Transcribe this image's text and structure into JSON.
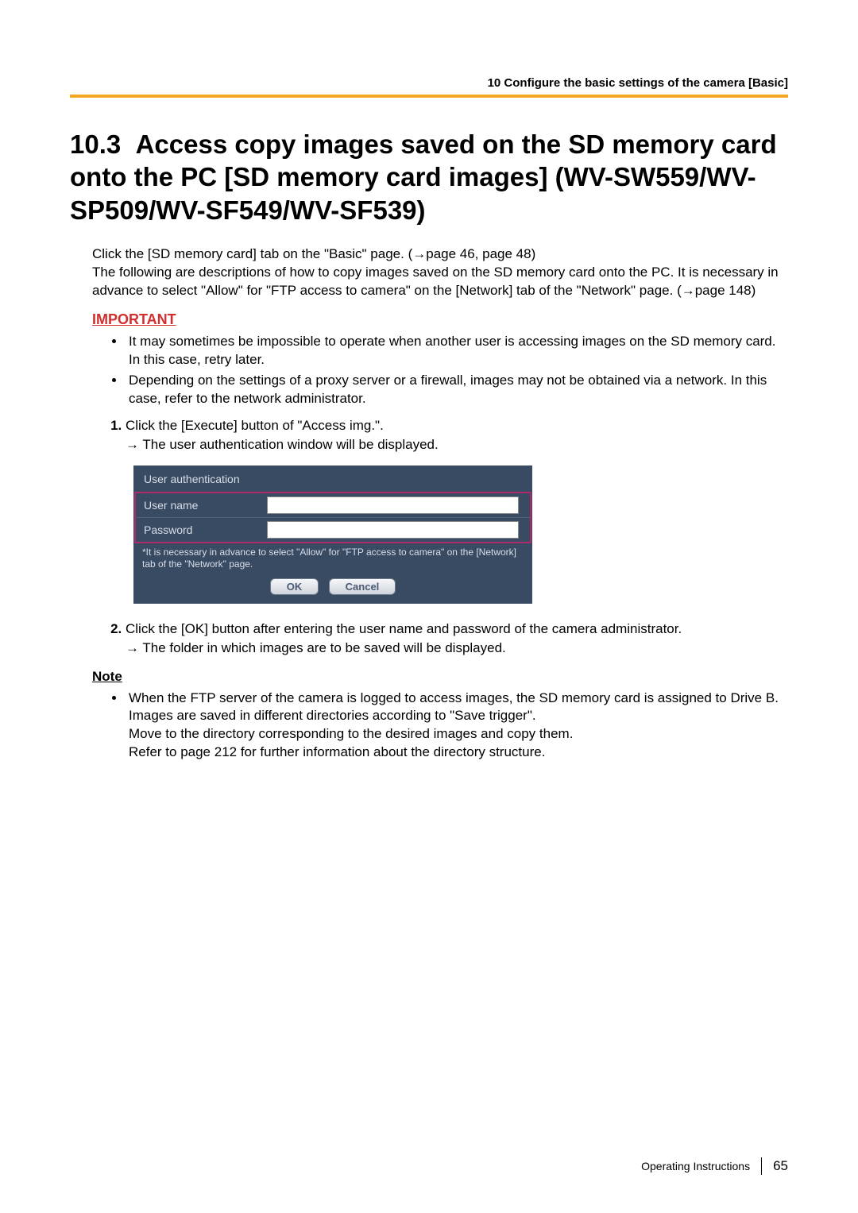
{
  "header": {
    "breadcrumb": "10 Configure the basic settings of the camera [Basic]"
  },
  "section": {
    "number": "10.3",
    "title": "Access copy images saved on the SD memory card onto the PC [SD memory card images] (WV-SW559/WV-SP509/WV-SF549/WV-SF539)"
  },
  "intro": {
    "line1": "Click the [SD memory card] tab on the \"Basic\" page. (→page 46, page 48)",
    "line2": "The following are descriptions of how to copy images saved on the SD memory card onto the PC. It is necessary in advance to select \"Allow\" for \"FTP access to camera\" on the [Network] tab of the \"Network\" page. (→page 148)"
  },
  "important": {
    "label": "IMPORTANT",
    "items": [
      "It may sometimes be impossible to operate when another user is accessing images on the SD memory card. In this case, retry later.",
      "Depending on the settings of a proxy server or a firewall, images may not be obtained via a network. In this case, refer to the network administrator."
    ]
  },
  "steps": [
    {
      "text": "Click the [Execute] button of \"Access img.\".",
      "arrow": "→  The user authentication window will be displayed."
    },
    {
      "text": "Click the [OK] button after entering the user name and password of the camera administrator.",
      "arrow": "→  The folder in which images are to be saved will be displayed."
    }
  ],
  "auth_panel": {
    "title": "User authentication",
    "username_label": "User name",
    "password_label": "Password",
    "username_value": "",
    "password_value": "",
    "note": "*It is necessary in advance to select \"Allow\" for \"FTP access to camera\" on the [Network] tab of the \"Network\" page.",
    "ok_label": "OK",
    "cancel_label": "Cancel"
  },
  "note": {
    "label": "Note",
    "items": [
      "When the FTP server of the camera is logged to access images, the SD memory card is assigned to Drive B.\nImages are saved in different directories according to \"Save trigger\".\nMove to the directory corresponding to the desired images and copy them.\nRefer to page 212 for further information about the directory structure."
    ]
  },
  "footer": {
    "doc_title": "Operating Instructions",
    "page_number": "65"
  }
}
